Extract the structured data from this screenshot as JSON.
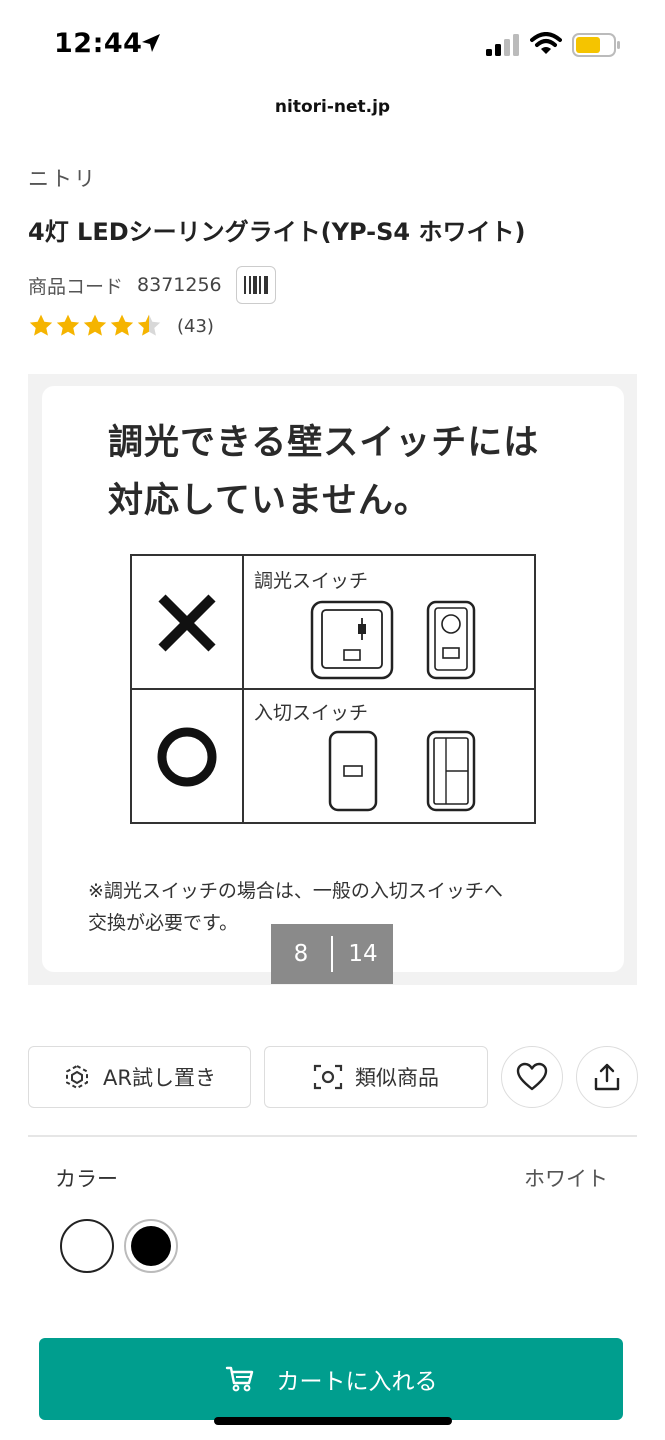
{
  "status_bar": {
    "time": "12:44"
  },
  "browser": {
    "url": "nitori-net.jp"
  },
  "product": {
    "brand": "ニトリ",
    "title": "4灯 LEDシーリングライト(YP-S4 ホワイト)",
    "code_label": "商品コード",
    "code_value": "8371256",
    "rating": 4.5,
    "review_count": "(43)"
  },
  "image": {
    "heading_line1": "調光できる壁スイッチには",
    "heading_line2": "対応していません。",
    "row1_label": "調光スイッチ",
    "row2_label": "入切スイッチ",
    "note_line1": "※調光スイッチの場合は、一般の入切スイッチへ",
    "note_line2": "交換が必要です。"
  },
  "gallery": {
    "current": "8",
    "total": "14"
  },
  "actions": {
    "ar_label": "AR試し置き",
    "similar_label": "類似商品"
  },
  "color": {
    "label": "カラー",
    "selected": "ホワイト",
    "swatches": [
      "#ffffff",
      "#000000"
    ]
  },
  "cart": {
    "label": "カートに入れる"
  },
  "colors": {
    "accent": "#009e8e",
    "star": "#f5b400"
  }
}
